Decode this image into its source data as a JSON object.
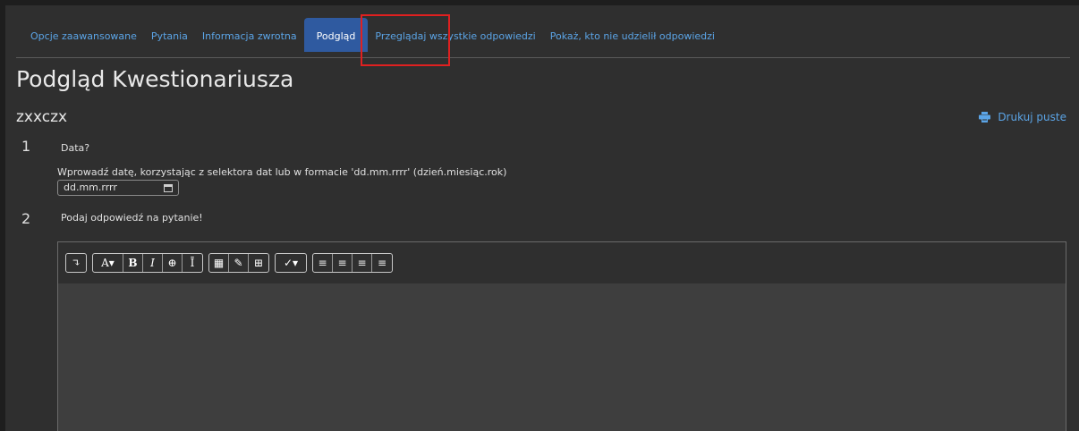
{
  "tabs": [
    {
      "label": "Opcje zaawansowane",
      "active": false
    },
    {
      "label": "Pytania",
      "active": false
    },
    {
      "label": "Informacja zwrotna",
      "active": false
    },
    {
      "label": "Podgląd",
      "active": true
    },
    {
      "label": "Przeglądaj wszystkie odpowiedzi",
      "active": false
    },
    {
      "label": "Pokaż, kto nie udzielił odpowiedzi",
      "active": false
    }
  ],
  "page": {
    "title": "Podgląd Kwestionariusza",
    "survey_name": "zxxczx",
    "print_label": "Drukuj puste"
  },
  "questions": [
    {
      "number": "1",
      "text": "Data?",
      "help": "Wprowadź datę, korzystając z selektora dat lub w formacie 'dd.mm.rrrr' (dzień.miesiąc.rok)",
      "input_placeholder": "dd.mm.rrrr"
    },
    {
      "number": "2",
      "text": "Podaj odpowiedź na pytanie!"
    }
  ],
  "editor": {
    "toolbar": {
      "expand": "↴",
      "font": "A▾",
      "bold": "B",
      "italic": "I",
      "find": "⊕",
      "cursor": "Ī",
      "calc": "▦",
      "edit": "✎",
      "table": "⊞",
      "brush": "✓▾",
      "ul": "≡",
      "ol": "≡",
      "outdent": "≡",
      "indent": "≡"
    }
  },
  "colors": {
    "accent": "#5ba4e6",
    "active_tab": "#2f5aa0",
    "highlight": "#e02020"
  }
}
